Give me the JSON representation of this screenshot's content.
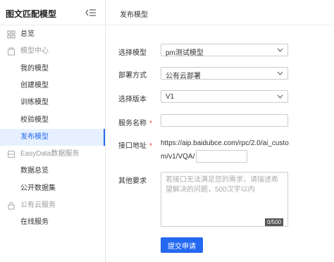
{
  "sidebar": {
    "title": "图文匹配模型",
    "items": [
      {
        "label": "总览"
      },
      {
        "label": "模型中心"
      },
      {
        "label": "我的模型"
      },
      {
        "label": "创建模型"
      },
      {
        "label": "训练模型"
      },
      {
        "label": "校验模型"
      },
      {
        "label": "发布模型"
      },
      {
        "label": "EasyData数据服务"
      },
      {
        "label": "数据总览"
      },
      {
        "label": "公开数据集"
      },
      {
        "label": "公有云服务"
      },
      {
        "label": "在线服务"
      }
    ]
  },
  "header": {
    "title": "发布模型"
  },
  "form": {
    "model": {
      "label": "选择模型",
      "value": "pm测试模型"
    },
    "deploy": {
      "label": "部署方式",
      "value": "公有云部署"
    },
    "version": {
      "label": "选择版本",
      "value": "V1"
    },
    "service_name": {
      "label": "服务名称",
      "value": "",
      "required_mark": "*"
    },
    "endpoint": {
      "label": "接口地址",
      "required_mark": "*",
      "prefix_line1": "https://aip.baidubce.com/rpc/2.0/ai_custo",
      "prefix_line2": "m/v1/VQA/",
      "value": ""
    },
    "other": {
      "label": "其他要求",
      "placeholder": "若接口无法满足您的需求，请描述希望解决的问题，500汉字以内",
      "counter": "0/500"
    },
    "submit_label": "提交申请"
  },
  "colors": {
    "accent": "#2468f2",
    "active_bg": "#e6f0ff",
    "required": "#ff3333"
  }
}
